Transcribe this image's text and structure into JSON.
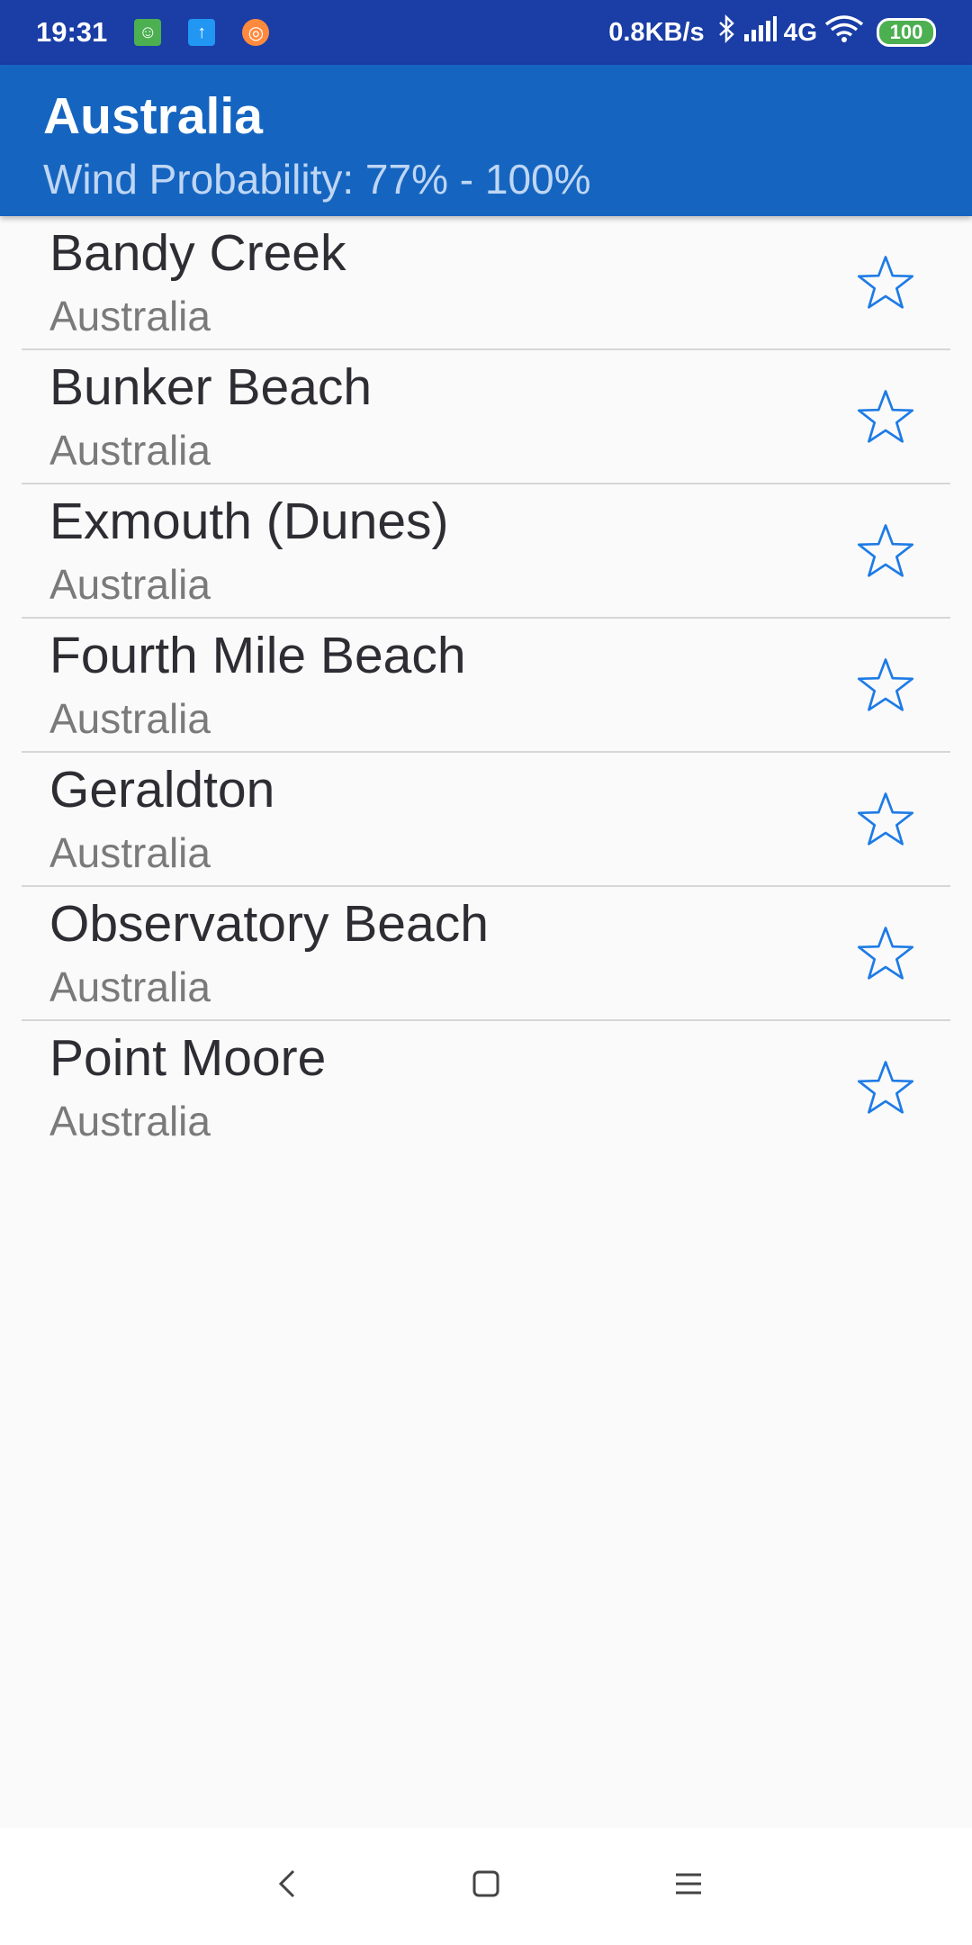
{
  "status_bar": {
    "time": "19:31",
    "net_speed": "0.8KB/s",
    "network_type": "4G",
    "battery": "100",
    "icons": [
      "android-notification-icon",
      "upload-icon",
      "orange-app-icon",
      "bluetooth-icon",
      "signal-icon",
      "wifi-icon",
      "battery-icon"
    ]
  },
  "app_bar": {
    "title": "Australia",
    "subtitle": "Wind Probability: 77% - 100%"
  },
  "spots": [
    {
      "name": "Bandy Creek",
      "country": "Australia",
      "favorite": false
    },
    {
      "name": "Bunker Beach",
      "country": "Australia",
      "favorite": false
    },
    {
      "name": "Exmouth (Dunes)",
      "country": "Australia",
      "favorite": false
    },
    {
      "name": "Fourth Mile Beach",
      "country": "Australia",
      "favorite": false
    },
    {
      "name": "Geraldton",
      "country": "Australia",
      "favorite": false
    },
    {
      "name": "Observatory Beach",
      "country": "Australia",
      "favorite": false
    },
    {
      "name": "Point Moore",
      "country": "Australia",
      "favorite": false
    }
  ],
  "colors": {
    "status_bar": "#1a3da6",
    "app_bar": "#1565c0",
    "star": "#1e7be6"
  },
  "nav_bar": {
    "icons": [
      "back-icon",
      "home-icon",
      "menu-icon"
    ]
  }
}
